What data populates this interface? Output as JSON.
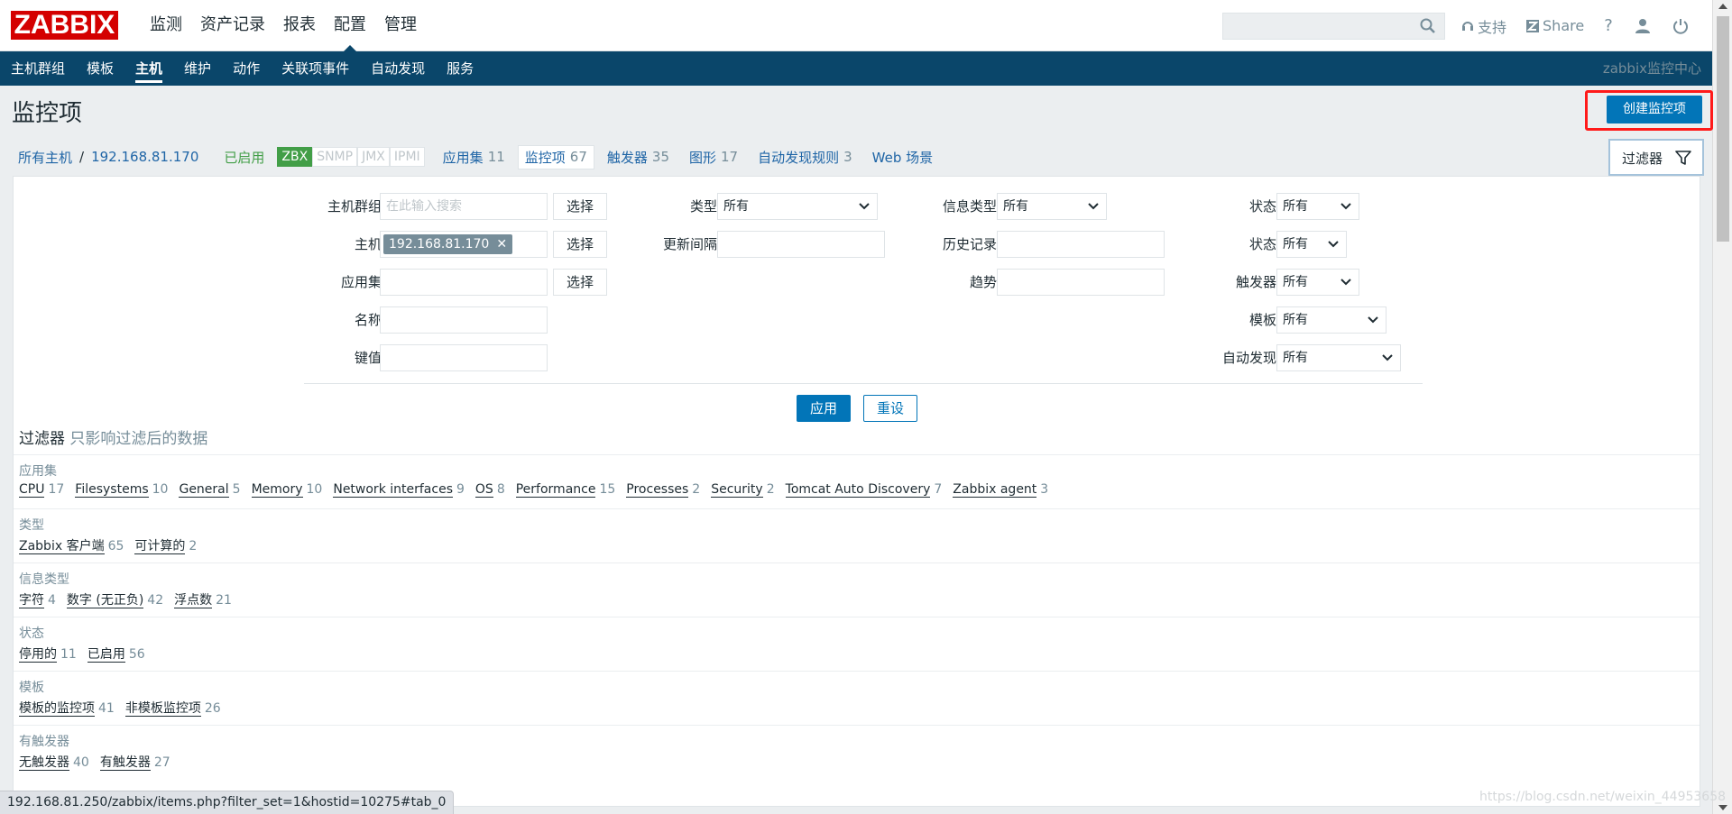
{
  "header": {
    "logo": "ZABBIX",
    "menu": [
      {
        "label": "监测",
        "active": false
      },
      {
        "label": "资产记录",
        "active": false
      },
      {
        "label": "报表",
        "active": false
      },
      {
        "label": "配置",
        "active": true
      },
      {
        "label": "管理",
        "active": false
      }
    ],
    "search_placeholder": "",
    "support_label": "支持",
    "share_label": "Share",
    "help_label": "?"
  },
  "submenu": {
    "items": [
      {
        "label": "主机群组",
        "active": false
      },
      {
        "label": "模板",
        "active": false
      },
      {
        "label": "主机",
        "active": true
      },
      {
        "label": "维护",
        "active": false
      },
      {
        "label": "动作",
        "active": false
      },
      {
        "label": "关联项事件",
        "active": false
      },
      {
        "label": "自动发现",
        "active": false
      },
      {
        "label": "服务",
        "active": false
      }
    ],
    "server_name": "zabbix监控中心"
  },
  "page": {
    "title": "监控项",
    "create_button": "创建监控项"
  },
  "hostnav": {
    "all_hosts": "所有主机",
    "separator": "/",
    "host": "192.168.81.170",
    "status": "已启用",
    "availability": [
      "ZBX",
      "SNMP",
      "JMX",
      "IPMI"
    ],
    "tabs": [
      {
        "label": "应用集",
        "count": "11"
      },
      {
        "label": "监控项",
        "count": "67",
        "current": true
      },
      {
        "label": "触发器",
        "count": "35"
      },
      {
        "label": "图形",
        "count": "17"
      },
      {
        "label": "自动发现规则",
        "count": "3"
      },
      {
        "label": "Web 场景",
        "count": ""
      }
    ],
    "filter_tab": "过滤器"
  },
  "filter": {
    "hostgroup_label": "主机群组",
    "hostgroup_placeholder": "在此输入搜索",
    "host_label": "主机",
    "host_chip": "192.168.81.170",
    "application_label": "应用集",
    "name_label": "名称",
    "key_label": "键值",
    "select_label": "选择",
    "type_label": "类型",
    "type_value": "所有",
    "interval_label": "更新间隔",
    "infotype_label": "信息类型",
    "infotype_value": "所有",
    "history_label": "历史记录",
    "trends_label": "趋势",
    "state_label": "状态",
    "state_value": "所有",
    "status_label": "状态",
    "status_value": "所有",
    "triggers_label": "触发器",
    "triggers_value": "所有",
    "template_label": "模板",
    "template_value": "所有",
    "discovery_label": "自动发现",
    "discovery_value": "所有",
    "apply_label": "应用",
    "reset_label": "重设"
  },
  "subfilter": {
    "title": "过滤器",
    "note": "只影响过滤后的数据",
    "sections": [
      {
        "title": "应用集",
        "items": [
          {
            "label": "CPU",
            "count": "17"
          },
          {
            "label": "Filesystems",
            "count": "10"
          },
          {
            "label": "General",
            "count": "5"
          },
          {
            "label": "Memory",
            "count": "10"
          },
          {
            "label": "Network interfaces",
            "count": "9"
          },
          {
            "label": "OS",
            "count": "8"
          },
          {
            "label": "Performance",
            "count": "15"
          },
          {
            "label": "Processes",
            "count": "2"
          },
          {
            "label": "Security",
            "count": "2"
          },
          {
            "label": "Tomcat Auto Discovery",
            "count": "7"
          },
          {
            "label": "Zabbix agent",
            "count": "3"
          }
        ]
      },
      {
        "title": "类型",
        "items": [
          {
            "label": "Zabbix 客户端",
            "count": "65"
          },
          {
            "label": "可计算的",
            "count": "2"
          }
        ]
      },
      {
        "title": "信息类型",
        "items": [
          {
            "label": "字符",
            "count": "4"
          },
          {
            "label": "数字 (无正负)",
            "count": "42"
          },
          {
            "label": "浮点数",
            "count": "21"
          }
        ]
      },
      {
        "title": "状态",
        "items": [
          {
            "label": "停用的",
            "count": "11"
          },
          {
            "label": "已启用",
            "count": "56"
          }
        ]
      },
      {
        "title": "模板",
        "items": [
          {
            "label": "模板的监控项",
            "count": "41"
          },
          {
            "label": "非模板监控项",
            "count": "26"
          }
        ]
      },
      {
        "title": "有触发器",
        "items": [
          {
            "label": "无触发器",
            "count": "40"
          },
          {
            "label": "有触发器",
            "count": "27"
          }
        ]
      }
    ]
  },
  "statusbar": {
    "url": "192.168.81.250/zabbix/items.php?filter_set=1&hostid=10275#tab_0"
  },
  "watermark": "https://blog.csdn.net/weixin_44953658"
}
